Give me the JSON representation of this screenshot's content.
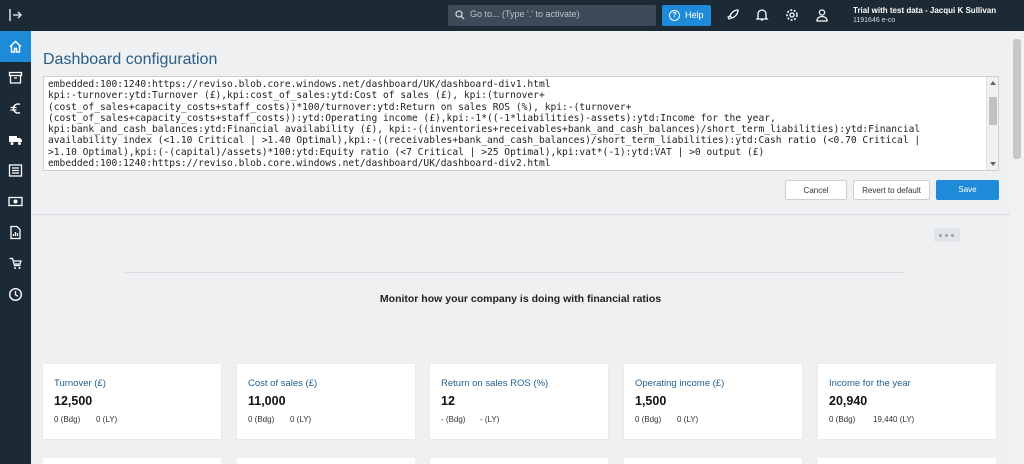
{
  "topbar": {
    "search_placeholder": "Go to... (Type '.' to activate)",
    "help_label": "Help",
    "user_name": "Trial with test data - Jacqui K Sullivan",
    "user_sub": "1191646 e-co"
  },
  "sidenav": {
    "items": [
      {
        "name": "home",
        "active": true
      },
      {
        "name": "archive",
        "active": false
      },
      {
        "name": "euro",
        "active": false
      },
      {
        "name": "truck",
        "active": false
      },
      {
        "name": "list",
        "active": false
      },
      {
        "name": "money",
        "active": false
      },
      {
        "name": "report",
        "active": false
      },
      {
        "name": "tag",
        "active": false
      },
      {
        "name": "clock",
        "active": false
      }
    ]
  },
  "config": {
    "title": "Dashboard configuration",
    "text": "embedded:100:1240:https://reviso.blob.core.windows.net/dashboard/UK/dashboard-div1.html\nkpi:-turnover:ytd:Turnover (£),kpi:cost_of_sales:ytd:Cost of sales (£), kpi:(turnover+\n(cost_of_sales+capacity_costs+staff_costs))*100/turnover:ytd:Return on sales ROS (%), kpi:-(turnover+\n(cost_of_sales+capacity_costs+staff_costs)):ytd:Operating income (£),kpi:-1*((-1*liabilities)-assets):ytd:Income for the year,\nkpi:bank_and_cash_balances:ytd:Financial availability (£), kpi:-((inventories+receivables+bank_and_cash_balances)/short_term_liabilities):ytd:Financial\navailability index (<1.10 Critical | >1.40 Optimal),kpi:-((receivables+bank_and_cash_balances)/short_term_liabilities):ytd:Cash ratio (<0.70 Critical |\n>1.10 Optimal),kpi:(-(capital)/assets)*100:ytd:Equity ratio (<7 Critical | >25 Optimal),kpi:vat*(-1):ytd:VAT | >0 output (£)\nembedded:100:1240:https://reviso.blob.core.windows.net/dashboard/UK/dashboard-div2.html",
    "cancel_label": "Cancel",
    "revert_label": "Revert to default",
    "save_label": "Save"
  },
  "dashboard": {
    "heading": "Monitor how your company is doing with financial ratios",
    "cards": [
      {
        "title": "Turnover (£)",
        "value": "12,500",
        "bdg": "0 (Bdg)",
        "ly": "0 (LY)"
      },
      {
        "title": "Cost of sales (£)",
        "value": "11,000",
        "bdg": "0 (Bdg)",
        "ly": "0 (LY)"
      },
      {
        "title": "Return on sales ROS (%)",
        "value": "12",
        "bdg": "- (Bdg)",
        "ly": "- (LY)"
      },
      {
        "title": "Operating income (£)",
        "value": "1,500",
        "bdg": "0 (Bdg)",
        "ly": "0 (LY)"
      },
      {
        "title": "Income for the year",
        "value": "20,940",
        "bdg": "0 (Bdg)",
        "ly": "19,440 (LY)"
      }
    ]
  },
  "colors": {
    "nav_bg": "#1b2a35",
    "accent": "#1d8bd8",
    "title_blue": "#2b5d86"
  }
}
